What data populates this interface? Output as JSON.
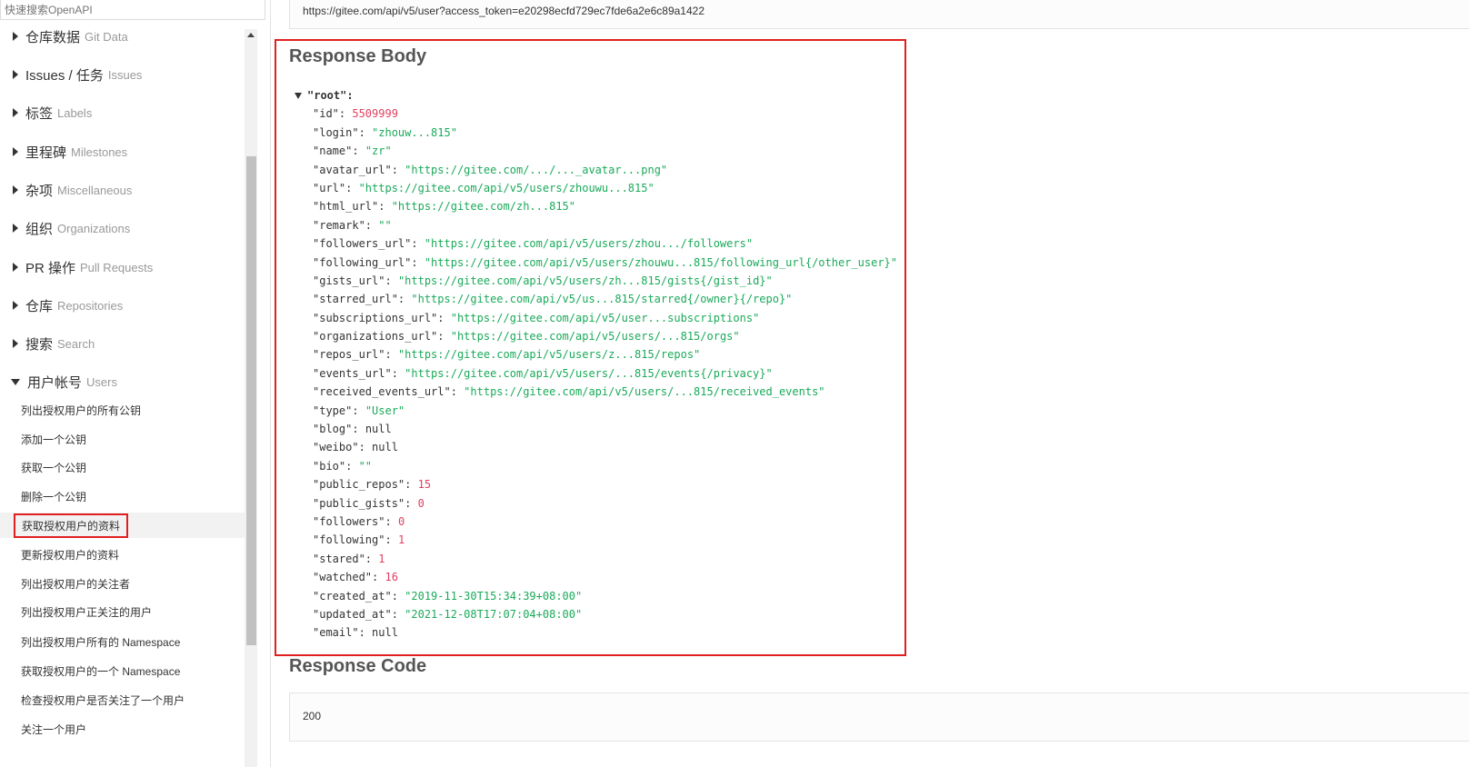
{
  "sidebar": {
    "search_placeholder": "快速搜索OpenAPI",
    "groups": [
      {
        "zh": "仓库数据",
        "en": "Git Data"
      },
      {
        "zh": "Issues / 任务",
        "en": "Issues"
      },
      {
        "zh": "标签",
        "en": "Labels"
      },
      {
        "zh": "里程碑",
        "en": "Milestones"
      },
      {
        "zh": "杂项",
        "en": "Miscellaneous"
      },
      {
        "zh": "组织",
        "en": "Organizations"
      },
      {
        "zh": "PR 操作",
        "en": "Pull Requests"
      },
      {
        "zh": "仓库",
        "en": "Repositories"
      },
      {
        "zh": "搜索",
        "en": "Search"
      },
      {
        "zh": "用户帐号",
        "en": "Users"
      }
    ],
    "items": [
      "列出授权用户的所有公钥",
      "添加一个公钥",
      "获取一个公钥",
      "删除一个公钥",
      "获取授权用户的资料",
      "更新授权用户的资料",
      "列出授权用户的关注者",
      "列出授权用户正关注的用户",
      "列出授权用户所有的 Namespace",
      "获取授权用户的一个 Namespace",
      "检查授权用户是否关注了一个用户",
      "关注一个用户"
    ]
  },
  "main": {
    "request_url": "https://gitee.com/api/v5/user?access_token=e20298ecfd729ec7fde6a2e6c89a1422",
    "response_body_title": "Response Body",
    "response_code_title": "Response Code",
    "response_code": "200",
    "json_root": "\"root\":",
    "json_rows": [
      {
        "k": "\"id\"",
        "v": "5509999",
        "t": "num"
      },
      {
        "k": "\"login\"",
        "v": "\"zhouw...815\"",
        "t": "str"
      },
      {
        "k": "\"name\"",
        "v": "\"zr\"",
        "t": "str"
      },
      {
        "k": "\"avatar_url\"",
        "v": "\"https://gitee.com/.../..._avatar...png\"",
        "t": "str"
      },
      {
        "k": "\"url\"",
        "v": "\"https://gitee.com/api/v5/users/zhouwu...815\"",
        "t": "str"
      },
      {
        "k": "\"html_url\"",
        "v": "\"https://gitee.com/zh...815\"",
        "t": "str"
      },
      {
        "k": "\"remark\"",
        "v": "\"\"",
        "t": "str"
      },
      {
        "k": "\"followers_url\"",
        "v": "\"https://gitee.com/api/v5/users/zhou.../followers\"",
        "t": "str"
      },
      {
        "k": "\"following_url\"",
        "v": "\"https://gitee.com/api/v5/users/zhouwu...815/following_url{/other_user}\"",
        "t": "str"
      },
      {
        "k": "\"gists_url\"",
        "v": "\"https://gitee.com/api/v5/users/zh...815/gists{/gist_id}\"",
        "t": "str"
      },
      {
        "k": "\"starred_url\"",
        "v": "\"https://gitee.com/api/v5/us...815/starred{/owner}{/repo}\"",
        "t": "str"
      },
      {
        "k": "\"subscriptions_url\"",
        "v": "\"https://gitee.com/api/v5/user...subscriptions\"",
        "t": "str"
      },
      {
        "k": "\"organizations_url\"",
        "v": "\"https://gitee.com/api/v5/users/...815/orgs\"",
        "t": "str"
      },
      {
        "k": "\"repos_url\"",
        "v": "\"https://gitee.com/api/v5/users/z...815/repos\"",
        "t": "str"
      },
      {
        "k": "\"events_url\"",
        "v": "\"https://gitee.com/api/v5/users/...815/events{/privacy}\"",
        "t": "str"
      },
      {
        "k": "\"received_events_url\"",
        "v": "\"https://gitee.com/api/v5/users/...815/received_events\"",
        "t": "str"
      },
      {
        "k": "\"type\"",
        "v": "\"User\"",
        "t": "str"
      },
      {
        "k": "\"blog\"",
        "v": "null",
        "t": "nul"
      },
      {
        "k": "\"weibo\"",
        "v": "null",
        "t": "nul"
      },
      {
        "k": "\"bio\"",
        "v": "\"\"",
        "t": "str"
      },
      {
        "k": "\"public_repos\"",
        "v": "15",
        "t": "num"
      },
      {
        "k": "\"public_gists\"",
        "v": "0",
        "t": "num"
      },
      {
        "k": "\"followers\"",
        "v": "0",
        "t": "num"
      },
      {
        "k": "\"following\"",
        "v": "1",
        "t": "num"
      },
      {
        "k": "\"stared\"",
        "v": "1",
        "t": "num"
      },
      {
        "k": "\"watched\"",
        "v": "16",
        "t": "num"
      },
      {
        "k": "\"created_at\"",
        "v": "\"2019-11-30T15:34:39+08:00\"",
        "t": "str"
      },
      {
        "k": "\"updated_at\"",
        "v": "\"2021-12-08T17:07:04+08:00\"",
        "t": "str"
      },
      {
        "k": "\"email\"",
        "v": "null",
        "t": "nul"
      }
    ]
  }
}
